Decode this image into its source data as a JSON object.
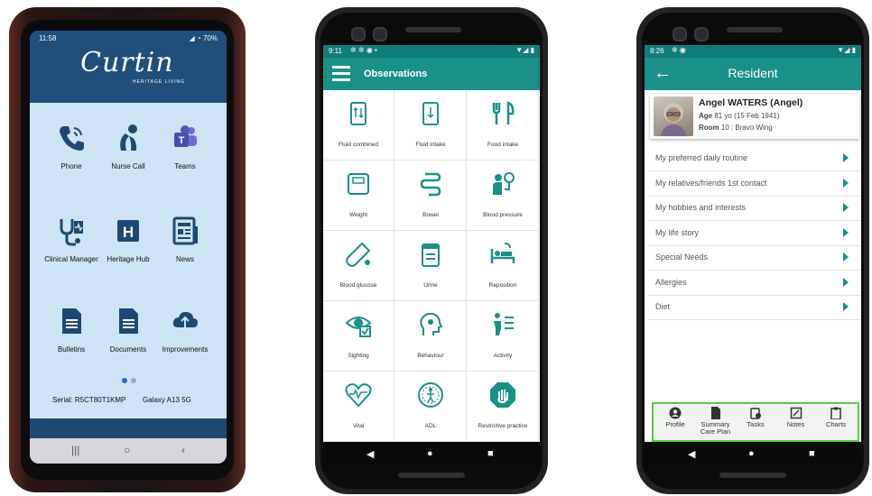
{
  "phone1": {
    "status": {
      "time": "11:58",
      "battery": "70%"
    },
    "logo": {
      "main": "Curtin",
      "sub": "HERITAGE LIVING"
    },
    "apps": [
      {
        "label": "Phone",
        "icon": "phone-icon"
      },
      {
        "label": "Nurse Call",
        "icon": "nurse-call-icon"
      },
      {
        "label": "Teams",
        "icon": "teams-icon"
      },
      {
        "label": "Clinical Manager",
        "icon": "clinical-manager-icon"
      },
      {
        "label": "Heritage Hub",
        "icon": "heritage-hub-icon"
      },
      {
        "label": "News",
        "icon": "news-icon"
      },
      {
        "label": "Bulletins",
        "icon": "bulletins-icon"
      },
      {
        "label": "Documents",
        "icon": "documents-icon"
      },
      {
        "label": "Improvements",
        "icon": "improvements-icon"
      }
    ],
    "serial": "Serial: R5CT80T1KMP",
    "model": "Galaxy A13 5G",
    "accent": "#1f4f7a",
    "screen_bg": "#cde4f4"
  },
  "phone2": {
    "status": {
      "time": "9:11"
    },
    "title": "Observations",
    "items": [
      {
        "label": "Fluid combined",
        "icon": "fluid-combined-icon"
      },
      {
        "label": "Fluid intake",
        "icon": "fluid-intake-icon"
      },
      {
        "label": "Food intake",
        "icon": "food-intake-icon"
      },
      {
        "label": "Weight",
        "icon": "weight-icon"
      },
      {
        "label": "Bowel",
        "icon": "bowel-icon"
      },
      {
        "label": "Blood pressure",
        "icon": "blood-pressure-icon"
      },
      {
        "label": "Blood glucose",
        "icon": "blood-glucose-icon"
      },
      {
        "label": "Urine",
        "icon": "urine-icon"
      },
      {
        "label": "Reposition",
        "icon": "reposition-icon"
      },
      {
        "label": "Sighting",
        "icon": "sighting-icon"
      },
      {
        "label": "Behaviour",
        "icon": "behaviour-icon"
      },
      {
        "label": "Activity",
        "icon": "activity-icon"
      },
      {
        "label": "Vital",
        "icon": "vital-icon"
      },
      {
        "label": "ADL",
        "icon": "adl-icon"
      },
      {
        "label": "Restrictive practice",
        "icon": "restrictive-practice-icon"
      }
    ],
    "accent": "#1a9188"
  },
  "phone3": {
    "status": {
      "time": "8:26"
    },
    "title": "Resident",
    "resident": {
      "name": "Angel WATERS (Angel)",
      "age_label": "Age",
      "age": "81 yo (15 Feb 1941)",
      "room_label": "Room",
      "room": "10",
      "wing": "Bravo Wing"
    },
    "rows": [
      "My preferred daily routine",
      "My relatives/friends 1st contact",
      "My hobbies and interests",
      "My life story",
      "Special Needs",
      "Allergies",
      "Diet"
    ],
    "bottom_nav": [
      {
        "label": "Profile",
        "icon": "profile-icon"
      },
      {
        "label": "Summary Care Plan",
        "icon": "summary-care-plan-icon"
      },
      {
        "label": "Tasks",
        "icon": "tasks-icon"
      },
      {
        "label": "Notes",
        "icon": "notes-icon"
      },
      {
        "label": "Charts",
        "icon": "charts-icon"
      }
    ],
    "highlight": "#59c94a"
  }
}
